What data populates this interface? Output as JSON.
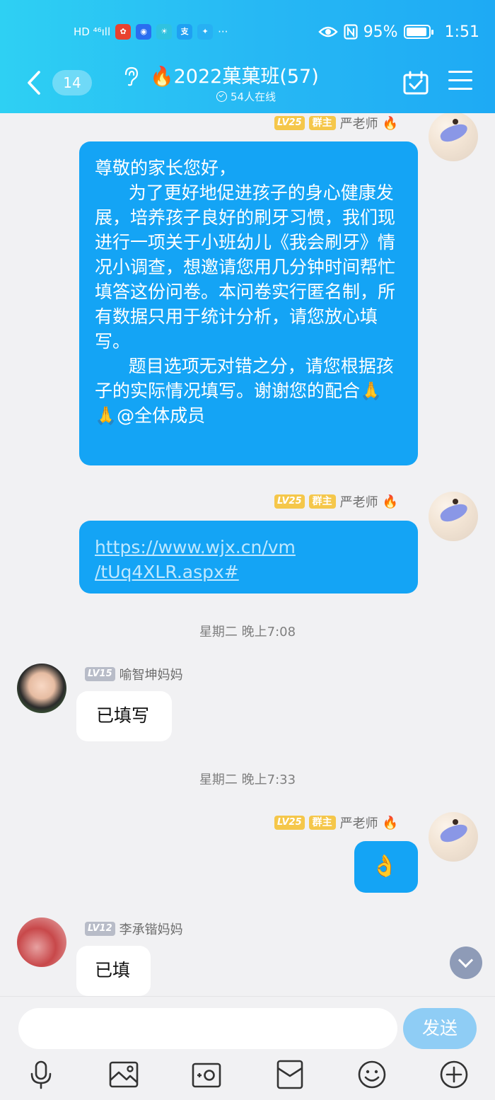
{
  "status_bar": {
    "left_text": "HD ⁴⁶ıll",
    "dots": "···",
    "battery": "95%",
    "time": "1:51"
  },
  "header": {
    "back_count": "14",
    "group_title": "🔥2022菓菓班(57)",
    "online": "54人在线"
  },
  "messages": [
    {
      "sender": "严老师",
      "level": "LV25",
      "role": "群主",
      "flame": "🔥",
      "text": "尊敬的家长您好，\n      为了更好地促进孩子的身心健康发展，培养孩子良好的刷牙习惯，我们现进行一项关于小班幼儿《我会刷牙》情况小调查，想邀请您用几分钟时间帮忙填答这份问卷。本问卷实行匿名制，所有数据只用于统计分析，请您放心填写。\n      题目选项无对错之分，请您根据孩子的实际情况填写。谢谢您的配合🙏🙏@全体成员"
    },
    {
      "sender": "严老师",
      "level": "LV25",
      "role": "群主",
      "flame": "🔥",
      "link": "https://www.wjx.cn/vm\n/tUq4XLR.aspx#"
    },
    {
      "time": "星期二 晚上7:08"
    },
    {
      "sender": "喻智坤妈妈",
      "level": "LV15",
      "text": "已填写"
    },
    {
      "time": "星期二 晚上7:33"
    },
    {
      "sender": "严老师",
      "level": "LV25",
      "role": "群主",
      "flame": "🔥",
      "text": "👌"
    },
    {
      "sender": "李承锴妈妈",
      "level": "LV12",
      "text": "已填"
    }
  ],
  "input": {
    "placeholder": "",
    "send_label": "发送"
  },
  "toolbar": [
    "microphone-icon",
    "image-icon",
    "camera-icon",
    "red-packet-icon",
    "emoji-icon",
    "plus-icon"
  ],
  "colors": {
    "header_start": "#2ed0f3",
    "header_end": "#1eaaf4",
    "bubble_blue": "#14a4f5",
    "level_gold": "#f5c74a",
    "send_button": "#8fcdf5"
  }
}
